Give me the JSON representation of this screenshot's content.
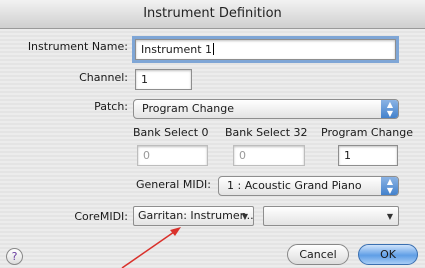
{
  "window": {
    "title": "Instrument Definition"
  },
  "instrument_name": {
    "label": "Instrument Name:",
    "value": "Instrument 1"
  },
  "channel": {
    "label": "Channel:",
    "value": "1"
  },
  "patch": {
    "label": "Patch:",
    "selected": "Program Change"
  },
  "bank_select_0": {
    "label": "Bank Select 0",
    "value": "0"
  },
  "bank_select_32": {
    "label": "Bank Select 32",
    "value": "0"
  },
  "program_change": {
    "label": "Program Change",
    "value": "1"
  },
  "general_midi": {
    "label": "General MIDI:",
    "selected": "1 : Acoustic Grand Piano"
  },
  "coremidi": {
    "label": "CoreMIDI:",
    "device": "Garritan: Instrumen...",
    "port": ""
  },
  "buttons": {
    "cancel": "Cancel",
    "ok": "OK",
    "help": "?"
  },
  "annotation": {
    "color": "#d9312b"
  }
}
